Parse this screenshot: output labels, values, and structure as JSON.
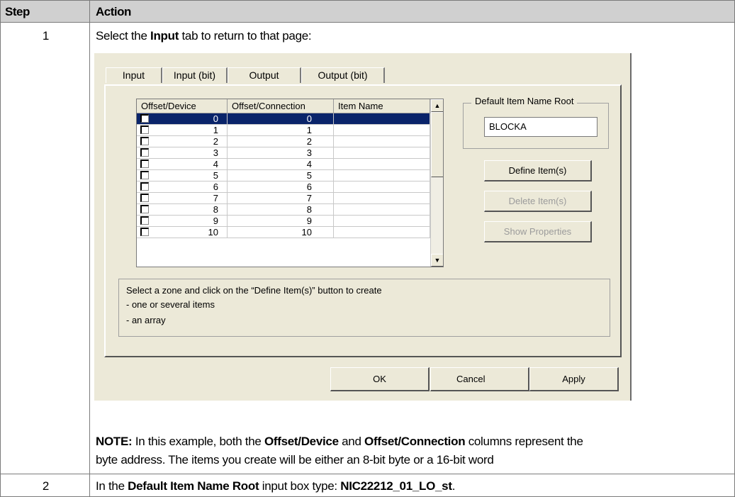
{
  "table": {
    "header_step": "Step",
    "header_action": "Action",
    "rows": [
      {
        "step": "1",
        "action_prefix": "Select the ",
        "action_bold": "Input",
        "action_suffix": " tab to return to that page:"
      },
      {
        "step": "2",
        "action_prefix": "In the ",
        "action_bold": "Default Item Name Root",
        "action_mid": " input box type: ",
        "action_bold2": "NIC22212_01_LO_st",
        "action_suffix": "."
      }
    ]
  },
  "note": {
    "label": "NOTE:",
    "t1": " In this example, both the ",
    "b1": "Offset/Device",
    "t2": " and ",
    "b2": "Offset/Connection",
    "t3": " columns represent the",
    "line2": "byte address. The items you create will be either an 8-bit byte or a 16-bit word"
  },
  "dialog": {
    "tabs": [
      "Input",
      "Input (bit)",
      "Output",
      "Output (bit)"
    ],
    "active_tab": "Input",
    "columns": [
      "Offset/Device",
      "Offset/Connection",
      "Item Name"
    ],
    "rows": [
      {
        "device": "0",
        "connection": "0",
        "name": ""
      },
      {
        "device": "1",
        "connection": "1",
        "name": ""
      },
      {
        "device": "2",
        "connection": "2",
        "name": ""
      },
      {
        "device": "3",
        "connection": "3",
        "name": ""
      },
      {
        "device": "4",
        "connection": "4",
        "name": ""
      },
      {
        "device": "5",
        "connection": "5",
        "name": ""
      },
      {
        "device": "6",
        "connection": "6",
        "name": ""
      },
      {
        "device": "7",
        "connection": "7",
        "name": ""
      },
      {
        "device": "8",
        "connection": "8",
        "name": ""
      },
      {
        "device": "9",
        "connection": "9",
        "name": ""
      },
      {
        "device": "10",
        "connection": "10",
        "name": ""
      }
    ],
    "selected_row": 0,
    "group_label": "Default Item Name Root",
    "root_value": "BLOCKA",
    "define_button": "Define Item(s)",
    "delete_button": "Delete Item(s)",
    "properties_button": "Show Properties",
    "hint_line1": "Select a zone and click on the “Define Item(s)” button to create",
    "hint_line2": "- one or several items",
    "hint_line3": "- an array",
    "ok_button": "OK",
    "cancel_button": "Cancel",
    "apply_button": "Apply"
  },
  "colors": {
    "header_bg": "#d0d0d0",
    "dialog_bg": "#ece9d8",
    "selection": "#0a246a"
  }
}
